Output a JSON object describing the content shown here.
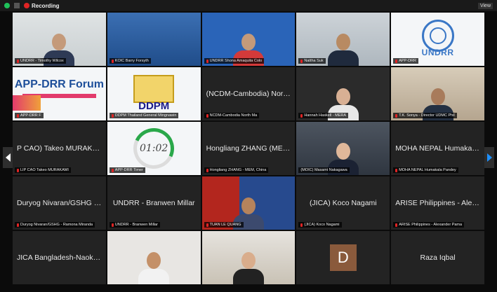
{
  "topbar": {
    "recording_label": "Recording",
    "view_label": "View"
  },
  "tiles": [
    {
      "label": "UNDRR - Timothy Wilcox"
    },
    {
      "label": "KOIC Barry Forsyth"
    },
    {
      "label": "UNDRR Shona Amaquita Colo"
    },
    {
      "label": "Nattha Suk"
    },
    {
      "label": "APP-DRR"
    },
    {
      "label": "APP-DRR F"
    },
    {
      "label": "DDPM Thailand General Mingnawin"
    },
    {
      "label": "NCDM-Cambodia North Ma",
      "center": "(NCDM-Cambodia) North..."
    },
    {
      "label": "Hannah Haskell - MERA"
    },
    {
      "label": "T.K. Sonya - Director UDMC Phil"
    },
    {
      "label": "LIP CAO Takeo MURAKAMI",
      "center": "P CAO) Takeo MURAKAMI"
    },
    {
      "label": "APP-DRR Timer",
      "timer": "01:02"
    },
    {
      "label": "Hongliang ZHANG - MEM, China",
      "center": "Hongliang ZHANG  (MEM..."
    },
    {
      "label": "(MOIC) Masami Nakagawa"
    },
    {
      "label": "MOHA NEPAL Humakala Pandey",
      "center": "MOHA NEPAL Humakala P"
    },
    {
      "label": "Duryog Nivaran/GSHG - Ramona Miranda",
      "center": "Duryog Nivaran/GSHG - Ra..."
    },
    {
      "label": "UNDRR - Branwen Millar",
      "center": "UNDRR - Branwen Millar"
    },
    {
      "label": "TUAN LE QUANG"
    },
    {
      "label": "(JICA) Koco Nagami",
      "center": "(JICA) Koco Nagami"
    },
    {
      "label": "ARISE Philippines - Alexander Pama",
      "center": "ARISE Philippines - Alexan..."
    },
    {
      "label": "",
      "center": "JICA Bangladesh-Naoki M..."
    },
    {
      "label": ""
    },
    {
      "label": ""
    },
    {
      "label": "",
      "avatar_letter": "D"
    },
    {
      "label": "",
      "center": "Raza Iqbal"
    }
  ],
  "logos": {
    "undrr": "UNDRR",
    "forum": "APP-DRR Forum",
    "ddpm": "DDPM"
  },
  "colors": {
    "active_speaker": "#c8e043",
    "mic_muted": "#e02424",
    "recording": "#e02424"
  }
}
